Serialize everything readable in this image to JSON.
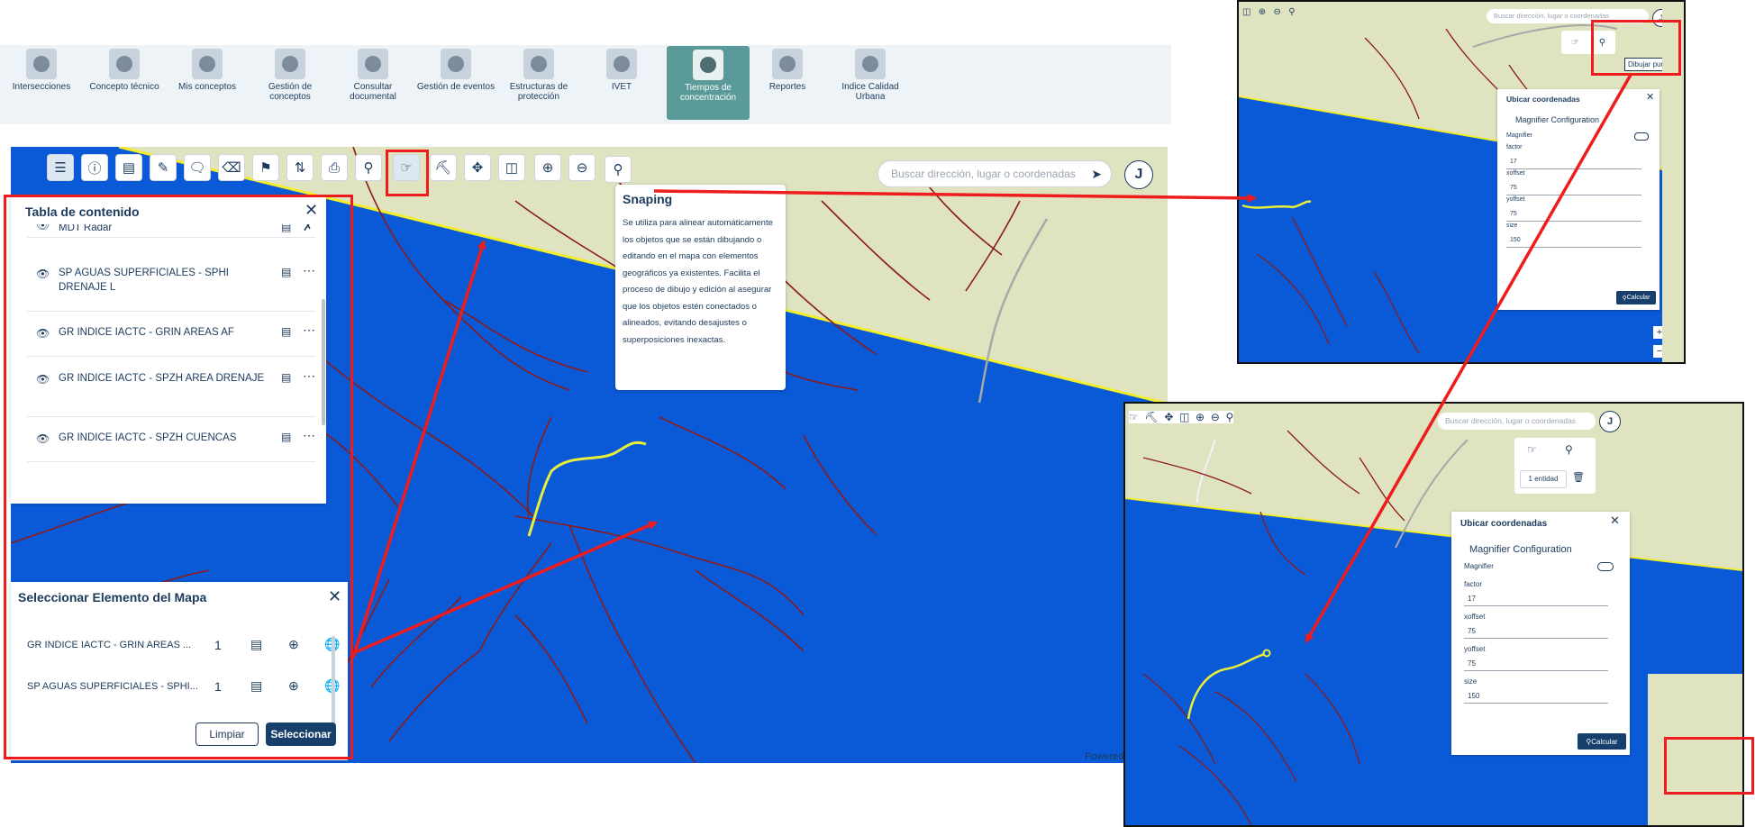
{
  "modules": [
    {
      "label": "Intersecciones",
      "icon": "intersection-icon",
      "active": false
    },
    {
      "label": "Concepto técnico",
      "icon": "presenter-icon",
      "active": false
    },
    {
      "label": "Mis conceptos",
      "icon": "people-icon",
      "active": false
    },
    {
      "label": "Gestión de conceptos",
      "icon": "document-icon",
      "active": false
    },
    {
      "label": "Consultar documental",
      "icon": "archive-icon",
      "active": false
    },
    {
      "label": "Gestión de eventos",
      "icon": "mountain-icon",
      "active": false
    },
    {
      "label": "Estructuras de protección",
      "icon": "structure-icon",
      "active": false
    },
    {
      "label": "IVET",
      "icon": "report-icon",
      "active": false
    },
    {
      "label": "Tiempos de concentración",
      "icon": "timer-icon",
      "active": true
    },
    {
      "label": "Reportes",
      "icon": "reports-icon",
      "active": false
    },
    {
      "label": "Indice Calidad Urbana",
      "icon": "city-icon",
      "active": false
    }
  ],
  "toolbar": [
    "layers-icon",
    "info-icon",
    "ruler-icon",
    "pencil-icon",
    "comment-icon",
    "eraser-icon",
    "flag-icon",
    "xyz-icon",
    "print-icon",
    "map-pin-edit-icon",
    "hand-pointer-icon",
    "magnifier-tool-icon",
    "pan-icon",
    "split-icon",
    "zoom-in-icon",
    "zoom-out-icon",
    "coordinates-icon"
  ],
  "search": {
    "placeholder": "Buscar dirección, lugar o coordenadas"
  },
  "user_initial": "J",
  "snapping": {
    "title": "Snaping",
    "text": "Se utiliza para alinear automáticamente los objetos que se están dibujando o editando en el mapa con elementos geográficos ya existentes. Facilita el proceso de dibujo y edición al asegurar que los objetos estén conectados o alineados, evitando desajustes o superposiciones inexactas."
  },
  "toc": {
    "title": "Tabla de contenido",
    "layers": [
      "MDT Radar",
      "SP AGUAS SUPERFICIALES - SPHI DRENAJE L",
      "GR INDICE IACTC - GRIN AREAS AF",
      "GR INDICE IACTC - SPZH AREA DRENAJE",
      "GR INDICE IACTC - SPZH CUENCAS"
    ]
  },
  "select_panel": {
    "title": "Seleccionar Elemento del Mapa",
    "rows": [
      {
        "name": "GR INDICE IACTC - GRIN AREAS ...",
        "count": "1"
      },
      {
        "name": "SP AGUAS SUPERFICIALES - SPHI...",
        "count": "1"
      }
    ],
    "clear_label": "Limpiar",
    "select_label": "Seleccionar"
  },
  "powered_label": "Powered",
  "inset_top": {
    "search_placeholder": "Buscar dirección, lugar o coordenadas",
    "tooltip": "Dibujar punto",
    "ubicar_title": "Ubicar coordenadas",
    "magnifier_title": "Magnifier Configuration",
    "fields": [
      {
        "label": "Magnifier",
        "value": ""
      },
      {
        "label": "factor",
        "value": "17"
      },
      {
        "label": "xoffset",
        "value": "75"
      },
      {
        "label": "yoffset",
        "value": "75"
      },
      {
        "label": "size",
        "value": "150"
      }
    ],
    "calc_label": "Calcular",
    "zoom_in": "+",
    "zoom_out": "−"
  },
  "inset_bottom": {
    "search_placeholder": "Buscar dirección, lugar o coordenadas",
    "entity_label": "1 entidad",
    "ubicar_title": "Ubicar coordenadas",
    "magnifier_title": "Magnifier Configuration",
    "fields": [
      {
        "label": "Magnifier",
        "value": ""
      },
      {
        "label": "factor",
        "value": "17"
      },
      {
        "label": "xoffset",
        "value": "75"
      },
      {
        "label": "yoffset",
        "value": "75"
      },
      {
        "label": "size",
        "value": "150"
      }
    ],
    "calc_label": "Calcular",
    "zoom_in": "+"
  },
  "colors": {
    "water": "#0a5ad8",
    "land": "#dfe3c0",
    "boundary": "#f2ee2a",
    "river": "#8b1a1a",
    "highlight": "#e9f03a",
    "callout": "#ee1c1c",
    "active_module": "#5a9a98"
  }
}
